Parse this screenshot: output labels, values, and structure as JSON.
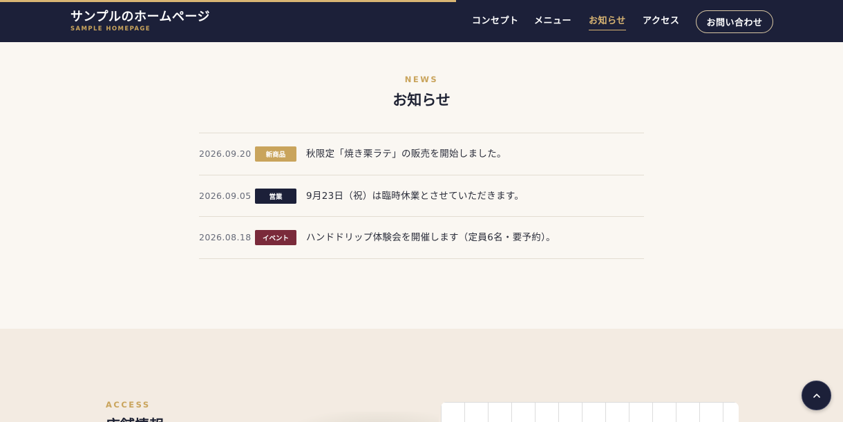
{
  "header": {
    "logo_title": "サンプルのホームページ",
    "logo_subtitle": "SAMPLE HOMEPAGE",
    "nav": [
      {
        "label": "コンセプト",
        "active": false
      },
      {
        "label": "メニュー",
        "active": false
      },
      {
        "label": "お知らせ",
        "active": true
      },
      {
        "label": "アクセス",
        "active": false
      }
    ],
    "contact_label": "お問い合わせ"
  },
  "news": {
    "eyebrow": "NEWS",
    "title": "お知らせ",
    "items": [
      {
        "date": "2026.09.20",
        "badge": "新商品",
        "badge_color": "#c9a45c",
        "text": "秋限定「焼き栗ラテ」の販売を開始しました。"
      },
      {
        "date": "2026.09.05",
        "badge": "営業",
        "badge_color": "#1c2039",
        "text": "9月23日（祝）は臨時休業とさせていただきます。"
      },
      {
        "date": "2026.08.18",
        "badge": "イベント",
        "badge_color": "#7a2a3a",
        "text": "ハンドドリップ体験会を開催します（定員6名・要予約）。"
      }
    ]
  },
  "access": {
    "eyebrow": "ACCESS",
    "title": "店舗情報"
  },
  "back_to_top_icon": "chevron-up-icon",
  "colors": {
    "navy": "#1c2039",
    "gold": "#c9a45c",
    "cream": "#faf7f2",
    "beige": "#f3ebe2"
  }
}
